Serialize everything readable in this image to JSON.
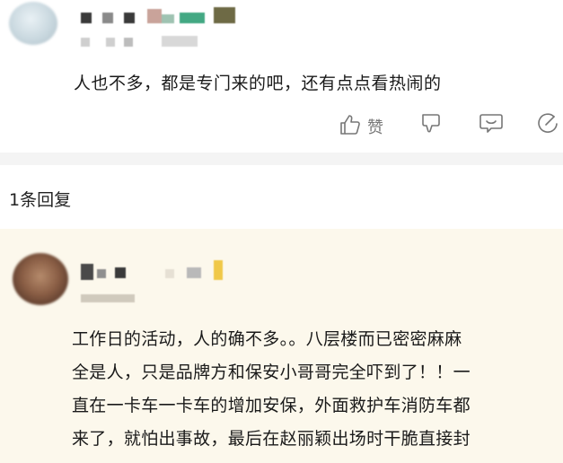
{
  "comment": {
    "text": "人也不多，都是专门来的吧，还有点点看热闹的",
    "actions": {
      "like_label": "赞"
    }
  },
  "replies": {
    "count_label": "1条回复",
    "items": [
      {
        "lines": [
          "工作日的活动，人的确不多。。八层楼而已密密麻麻",
          "全是人，只是品牌方和保安小哥哥完全吓到了！！一",
          "直在一卡车一卡车的增加安保，外面救护车消防车都",
          "来了，就怕出事故，最后在赵丽颖出场时干脆直接封"
        ]
      }
    ]
  },
  "colors": {
    "reply_background": "#fcf8ec",
    "divider": "#f4f4f4",
    "icon": "#777777"
  }
}
